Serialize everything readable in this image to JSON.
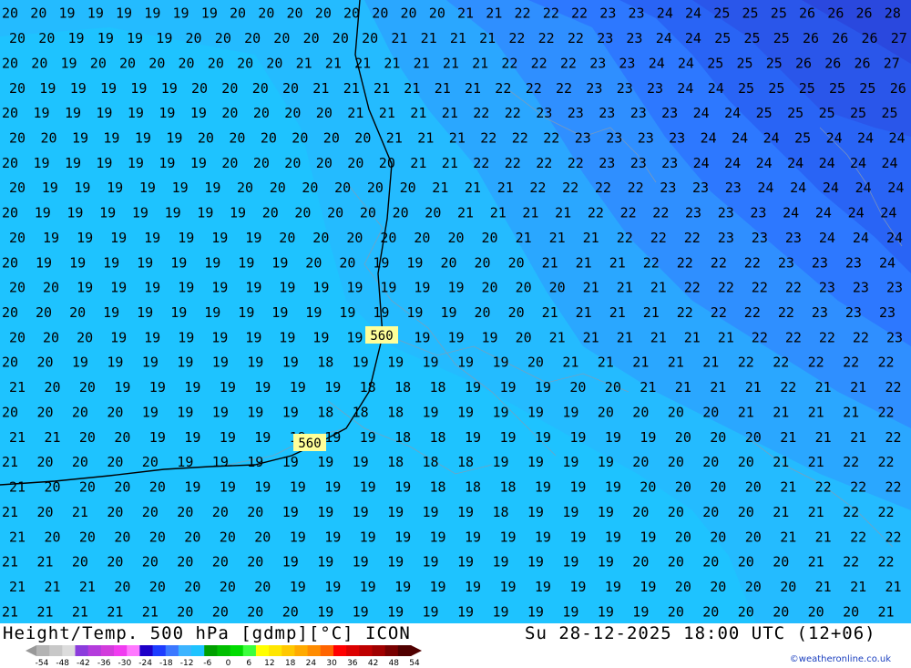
{
  "map": {
    "labels_560": [
      "560",
      "560"
    ],
    "height_contour_value": "560"
  },
  "temperature_grid": [
    "20 20 19 19 19 19 19 19 20 20 20 20 20 20 20 20 21 21 22 22 22 23 23 24 24 25 25 25 26 26 26 28",
    "20 20 19 19 19 19 20 20 20 20 20 20 20 21 21 21 21 22 22 22 23 23 24 24 25 25 25 26 26 26 27",
    "20 20 19 20 20 20 20 20 20 20 21 21 21 21 21 21 21 22 22 22 23 23 24 24 25 25 25 26 26 26 27",
    "20 19 19 19 19 19 20 20 20 20 21 21 21 21 21 21 22 22 22 23 23 23 24 24 25 25 25 25 25 26",
    "20 19 19 19 19 19 19 20 20 20 20 21 21 21 21 22 22 23 23 23 23 23 24 24 25 25 25 25 25",
    "20 20 19 19 19 19 20 20 20 20 20 20 21 21 21 22 22 22 23 23 23 23 24 24 24 25 24 24 24",
    "20 19 19 19 19 19 19 20 20 20 20 20 20 21 21 22 22 22 22 23 23 23 24 24 24 24 24 24 24",
    "20 19 19 19 19 19 19 20 20 20 20 20 20 21 21 21 22 22 22 22 23 23 23 24 24 24 24 24",
    "20 19 19 19 19 19 19 19 20 20 20 20 20 20 21 21 21 21 22 22 22 23 23 23 24 24 24 24",
    "20 19 19 19 19 19 19 19 20 20 20 20 20 20 20 21 21 21 22 22 22 23 23 23 24 24 24",
    "20 19 19 19 19 19 19 19 19 20 20 19 19 20 20 20 21 21 21 22 22 22 22 23 23 23 24",
    "20 20 19 19 19 19 19 19 19 19 19 19 19 19 20 20 20 21 21 21 22 22 22 22 23 23 23",
    "20 20 20 19 19 19 19 19 19 19 19 19 19 19 20 20 21 21 21 21 22 22 22 22 23 23 23",
    "20 20 20 19 19 19 19 19 19 19 19 19 19 19 19 20 21 21 21 21 21 21 22 22 22 22 23",
    "20 20 19 19 19 19 19 19 19 18 19 19 19 19 19 20 21 21 21 21 21 22 22 22 22 22",
    "21 20 20 19 19 19 19 19 19 19 18 18 18 19 19 19 20 20 21 21 21 21 22 21 21 22",
    "20 20 20 20 19 19 19 19 19 18 18 18 19 19 19 19 19 20 20 20 20 21 21 21 21 22",
    "21 21 20 20 19 19 19 19 19 19 19 18 18 19 19 19 19 19 19 20 20 20 21 21 21 22",
    "21 20 20 20 20 19 19 19 19 19 19 18 18 18 19 19 19 19 20 20 20 20 21 21 22 22",
    "21 20 20 20 20 19 19 19 19 19 19 19 18 18 18 19 19 19 20 20 20 20 21 22 22 22",
    "21 20 21 20 20 20 20 20 19 19 19 19 19 19 18 19 19 19 20 20 20 20 21 21 22 22",
    "21 20 20 20 20 20 20 20 19 19 19 19 19 19 19 19 19 19 19 20 20 20 21 21 22 22",
    "21 21 20 20 20 20 20 20 19 19 19 19 19 19 19 19 19 19 20 20 20 20 20 21 22 22",
    "21 21 21 20 20 20 20 20 19 19 19 19 19 19 19 19 19 19 19 20 20 20 20 21 21 21",
    "21 21 21 21 21 20 20 20 20 19 19 19 19 19 19 19 19 19 19 20 20 20 20 20 20 21"
  ],
  "footer": {
    "title": "Height/Temp. 500 hPa [gdmp][°C] ICON",
    "datetime": "Su 28-12-2025 18:00 UTC (12+06)",
    "credit": "©weatheronline.co.uk"
  },
  "legend": {
    "ticks": [
      "-54",
      "-48",
      "-42",
      "-36",
      "-30",
      "-24",
      "-18",
      "-12",
      "-6",
      "0",
      "6",
      "12",
      "18",
      "24",
      "30",
      "36",
      "42",
      "48",
      "54"
    ],
    "colors": [
      "#b4b4b4",
      "#c8c8c8",
      "#dcdcdc",
      "#8c3cdc",
      "#b43cdc",
      "#d23cdc",
      "#f03cf0",
      "#ff78ff",
      "#1e00c8",
      "#1e3cff",
      "#3c78ff",
      "#3cb4ff",
      "#1ec3ff",
      "#00a000",
      "#00be00",
      "#00dc00",
      "#3cff3c",
      "#ffff00",
      "#ffe600",
      "#ffc800",
      "#ffaa00",
      "#ff8c00",
      "#ff6400",
      "#ff0000",
      "#dc0000",
      "#be0000",
      "#a00000",
      "#780000",
      "#500000"
    ]
  },
  "palette": {
    "t18_19": "#1ec3ff",
    "t20": "#28b4ff",
    "t21": "#2d9bff",
    "t22": "#3282ff",
    "t23": "#2d6eff",
    "t24": "#285af0",
    "t25": "#2850e6",
    "t26": "#2846dc",
    "contour": "#000000"
  }
}
